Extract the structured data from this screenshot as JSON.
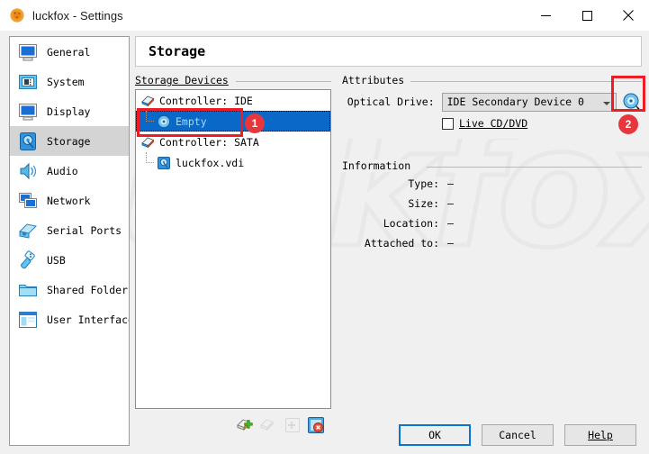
{
  "window": {
    "title": "luckfox - Settings",
    "app_icon": "virtualbox-icon",
    "minimize_label": "—",
    "maximize_label": "☐",
    "close_label": "✕"
  },
  "sidebar": {
    "items": [
      {
        "label": "General",
        "icon": "monitor-icon",
        "selected": false
      },
      {
        "label": "System",
        "icon": "motherboard-icon",
        "selected": false
      },
      {
        "label": "Display",
        "icon": "display-icon",
        "selected": false
      },
      {
        "label": "Storage",
        "icon": "harddisk-icon",
        "selected": true
      },
      {
        "label": "Audio",
        "icon": "speaker-icon",
        "selected": false
      },
      {
        "label": "Network",
        "icon": "network-icon",
        "selected": false
      },
      {
        "label": "Serial Ports",
        "icon": "serial-port-icon",
        "selected": false
      },
      {
        "label": "USB",
        "icon": "usb-icon",
        "selected": false
      },
      {
        "label": "Shared Folders",
        "icon": "folder-icon",
        "selected": false
      },
      {
        "label": "User Interface",
        "icon": "user-interface-icon",
        "selected": false
      }
    ]
  },
  "page": {
    "title": "Storage"
  },
  "storage_devices": {
    "group_label": "Storage Devices",
    "rows": [
      {
        "label": "Controller: IDE",
        "icon": "ide-controller-icon",
        "level": 0,
        "selected": false
      },
      {
        "label": "Empty",
        "icon": "optical-disc-icon",
        "level": 1,
        "selected": true
      },
      {
        "label": "Controller: SATA",
        "icon": "sata-controller-icon",
        "level": 0,
        "selected": false
      },
      {
        "label": "luckfox.vdi",
        "icon": "hard-disk-icon",
        "level": 1,
        "selected": false
      }
    ],
    "toolbar": [
      {
        "name": "add-controller-icon",
        "enabled": true
      },
      {
        "name": "remove-controller-icon",
        "enabled": false
      },
      {
        "name": "add-attachment-icon",
        "enabled": false
      },
      {
        "name": "remove-attachment-icon",
        "enabled": true
      }
    ]
  },
  "attributes": {
    "group_label": "Attributes",
    "optical_drive_label": "Optical Drive:",
    "optical_drive_value": "IDE Secondary Device 0",
    "browse_icon": "optical-disc-browse-icon",
    "live_cd_label": "Live CD/DVD",
    "live_cd_checked": false
  },
  "information": {
    "group_label": "Information",
    "rows": [
      {
        "key": "Type:",
        "value": "—"
      },
      {
        "key": "Size:",
        "value": "—"
      },
      {
        "key": "Location:",
        "value": "—"
      },
      {
        "key": "Attached to:",
        "value": "—"
      }
    ]
  },
  "footer": {
    "ok_label": "OK",
    "cancel_label": "Cancel",
    "help_label": "Help"
  },
  "annotations": {
    "badge_one": "1",
    "badge_two": "2",
    "highlight_color": "#ee1c25",
    "badge_color": "#e8373c"
  },
  "watermark": {
    "text": "luckfox"
  }
}
